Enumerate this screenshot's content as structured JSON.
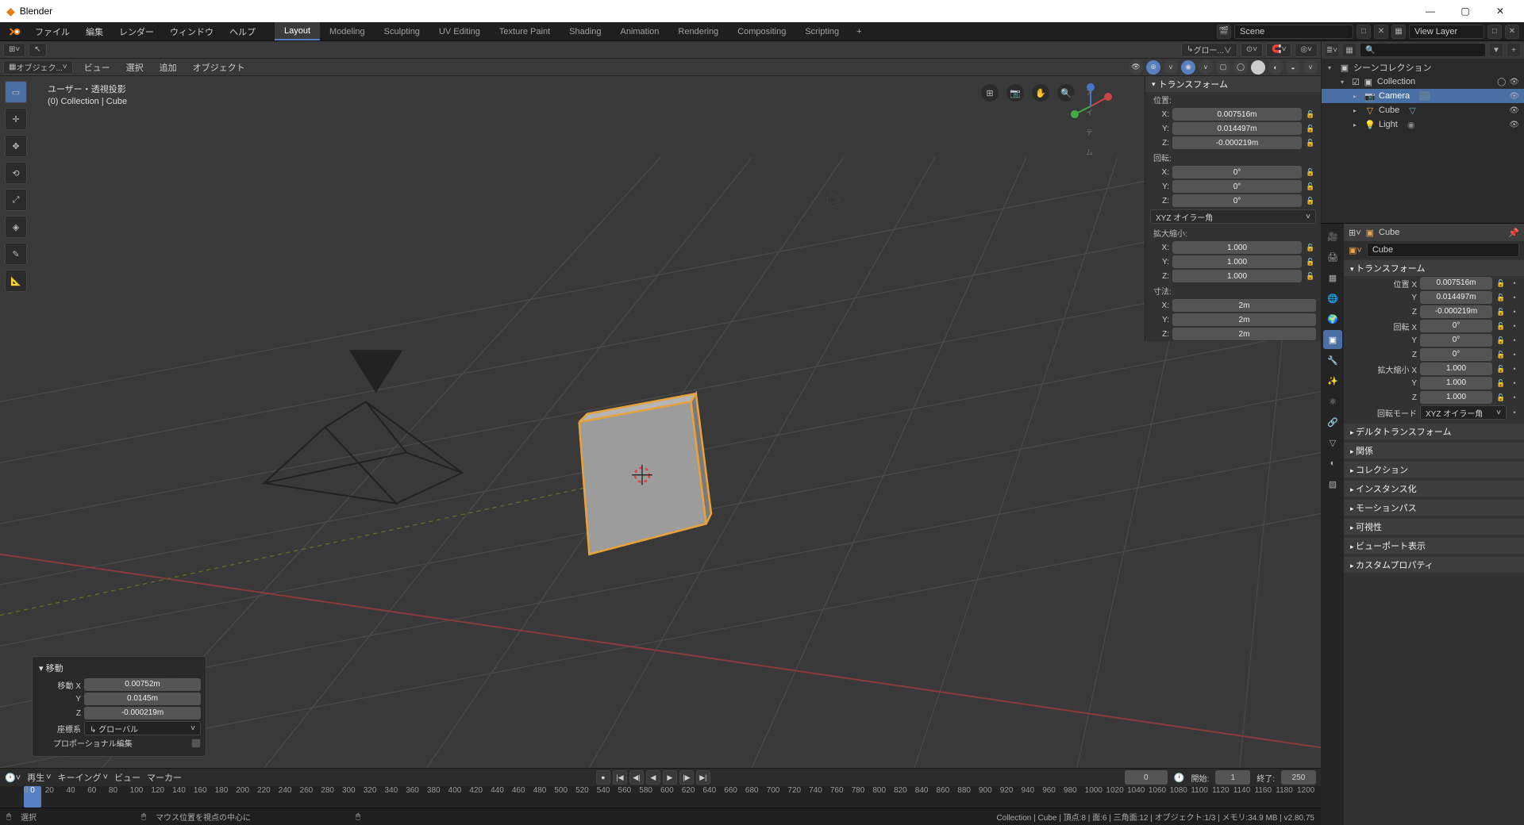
{
  "title": "Blender",
  "menu": [
    "ファイル",
    "編集",
    "レンダー",
    "ウィンドウ",
    "ヘルプ"
  ],
  "workspaces": [
    "Layout",
    "Modeling",
    "Sculpting",
    "UV Editing",
    "Texture Paint",
    "Shading",
    "Animation",
    "Rendering",
    "Compositing",
    "Scripting"
  ],
  "scene": {
    "label": "Scene",
    "layer": "View Layer"
  },
  "vp_header": {
    "global": "グロー...∨"
  },
  "vp_header2": {
    "mode": "オブジェク...",
    "view": "ビュー",
    "select": "選択",
    "add": "追加",
    "object": "オブジェクト"
  },
  "vp_info": {
    "line1": "ユーザー・透視投影",
    "line2": "(0) Collection | Cube"
  },
  "npanel": {
    "title": "トランスフォーム",
    "loc_label": "位置:",
    "loc": {
      "x": "0.007516m",
      "y": "0.014497m",
      "z": "-0.000219m"
    },
    "rot_label": "回転:",
    "rot": {
      "x": "0°",
      "y": "0°",
      "z": "0°"
    },
    "rotmode": "XYZ オイラー角",
    "scale_label": "拡大縮小:",
    "scale": {
      "x": "1.000",
      "y": "1.000",
      "z": "1.000"
    },
    "dim_label": "寸法:",
    "dim": {
      "x": "2m",
      "y": "2m",
      "z": "2m"
    }
  },
  "op": {
    "title": "移動",
    "rows": {
      "x_label": "移動 X",
      "x": "0.00752m",
      "y_label": "Y",
      "y": "0.0145m",
      "z_label": "Z",
      "z": "-0.000219m"
    },
    "orient_label": "座標系",
    "orient_value": "グローバル",
    "prop_label": "プロポーショナル編集"
  },
  "timeline": {
    "play": "再生",
    "keying": "キーイング",
    "view": "ビュー",
    "marker": "マーカー",
    "current": "0",
    "start_label": "開始:",
    "start": "1",
    "end_label": "終了:",
    "end": "250",
    "ticks": [
      0,
      20,
      40,
      60,
      80,
      100,
      120,
      140,
      160,
      180,
      200,
      220,
      240,
      260,
      280,
      300,
      320,
      340,
      360,
      380,
      400,
      420,
      440,
      460,
      480,
      500,
      520,
      540,
      560,
      580,
      600,
      620,
      640,
      660,
      680,
      700,
      720,
      740,
      760,
      780,
      800,
      820,
      840,
      860,
      880,
      900,
      920,
      940,
      960,
      980,
      1000,
      1020,
      1040,
      1060,
      1080,
      1100,
      1120,
      1140,
      1160,
      1180,
      1200
    ]
  },
  "status": {
    "left1": "選択",
    "mid": "マウス位置を視点の中心に",
    "right": "Collection | Cube | 頂点:8 | 面:6 | 三角面:12 | オブジェクト:1/3 | メモリ:34.9 MB | v2.80.75"
  },
  "outliner": {
    "title": "シーンコレクション",
    "collection": "Collection",
    "items": [
      {
        "name": "Camera",
        "type": "camera"
      },
      {
        "name": "Cube",
        "type": "mesh"
      },
      {
        "name": "Light",
        "type": "light"
      }
    ]
  },
  "props": {
    "breadcrumb": "Cube",
    "name": "Cube",
    "transform_title": "トランスフォーム",
    "loc": {
      "x_label": "位置 X",
      "x": "0.007516m",
      "y": "0.014497m",
      "z": "-0.000219m"
    },
    "rot": {
      "x_label": "回転 X",
      "x": "0°",
      "y": "0°",
      "z": "0°"
    },
    "scale": {
      "x_label": "拡大縮小 X",
      "x": "1.000",
      "y": "1.000",
      "z": "1.000"
    },
    "rotmode_label": "回転モード",
    "rotmode": "XYZ オイラー角",
    "sections": [
      "デルタトランスフォーム",
      "関係",
      "コレクション",
      "インスタンス化",
      "モーションパス",
      "可視性",
      "ビューポート表示",
      "カスタムプロパティ"
    ]
  }
}
